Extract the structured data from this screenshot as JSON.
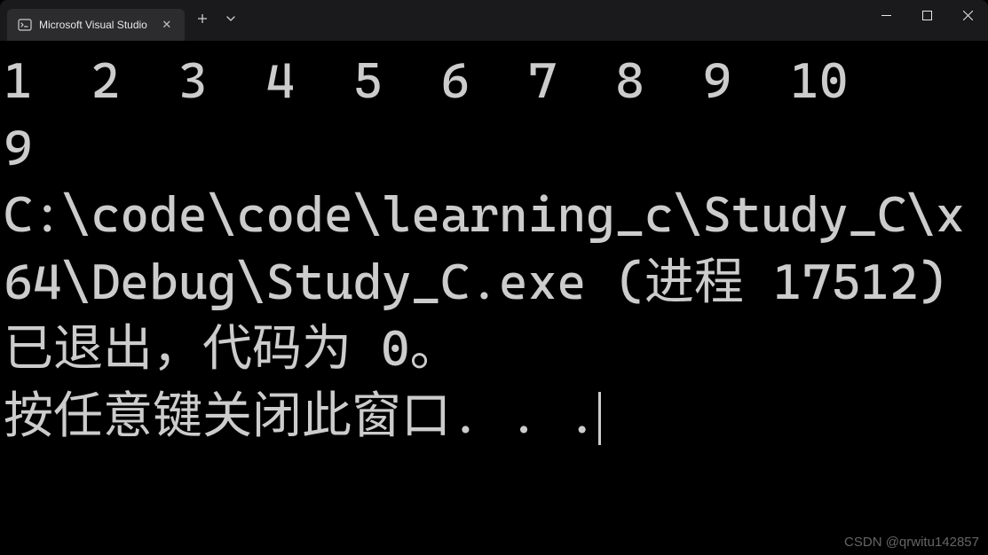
{
  "titlebar": {
    "tab": {
      "title": "Microsoft Visual Studio"
    }
  },
  "terminal": {
    "line1": "1  2  3  4  5  6  7  8  9  10",
    "line2": "9",
    "line3": "C:\\code\\code\\learning_c\\Study_C\\x64\\Debug\\Study_C.exe (进程 17512)已退出，代码为 0。",
    "line4": "按任意键关闭此窗口. . ."
  },
  "watermark": "CSDN @qrwitu142857"
}
